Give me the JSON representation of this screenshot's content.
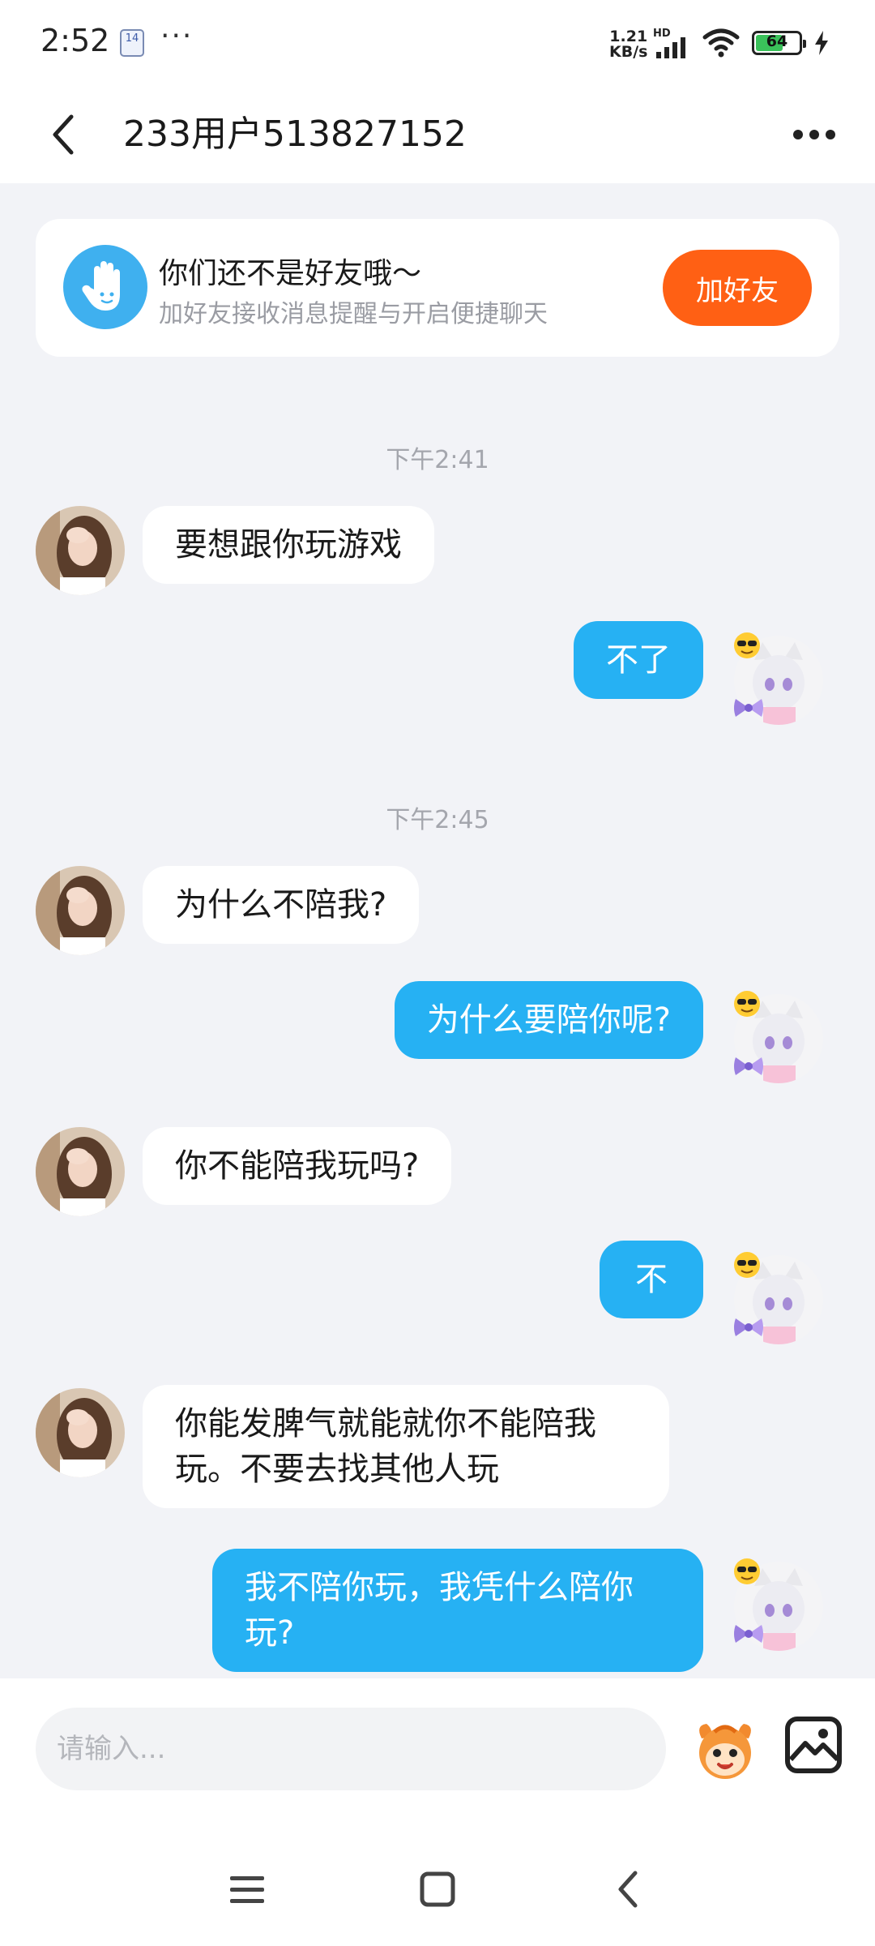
{
  "status_bar": {
    "time": "2:52",
    "app_badge": "14",
    "more": "···",
    "net_speed_value": "1.21",
    "net_speed_unit": "KB/s",
    "hd": "HD",
    "battery": "64"
  },
  "header": {
    "title": "233用户513827152"
  },
  "friend_card": {
    "title": "你们还不是好友哦～",
    "subtitle": "加好友接收消息提醒与开启便捷聊天",
    "button": "加好友"
  },
  "messages": [
    {
      "type": "time",
      "text": "下午2:41"
    },
    {
      "side": "left",
      "text": "要想跟你玩游戏"
    },
    {
      "side": "right",
      "text": "不了"
    },
    {
      "type": "time",
      "text": "下午2:45"
    },
    {
      "side": "left",
      "text": "为什么不陪我?"
    },
    {
      "side": "right",
      "text": "为什么要陪你呢?"
    },
    {
      "side": "left",
      "text": "你不能陪我玩吗?"
    },
    {
      "side": "right",
      "text": "不"
    },
    {
      "side": "left",
      "text": "你能发脾气就能就你不能陪我玩。不要去找其他人玩"
    },
    {
      "side": "right",
      "text": "我不陪你玩，我凭什么陪你玩?"
    }
  ],
  "input": {
    "placeholder": "请输入..."
  },
  "colors": {
    "accent_blue": "#26b1f3",
    "add_button": "#ff6014",
    "background": "#f2f3f7"
  }
}
